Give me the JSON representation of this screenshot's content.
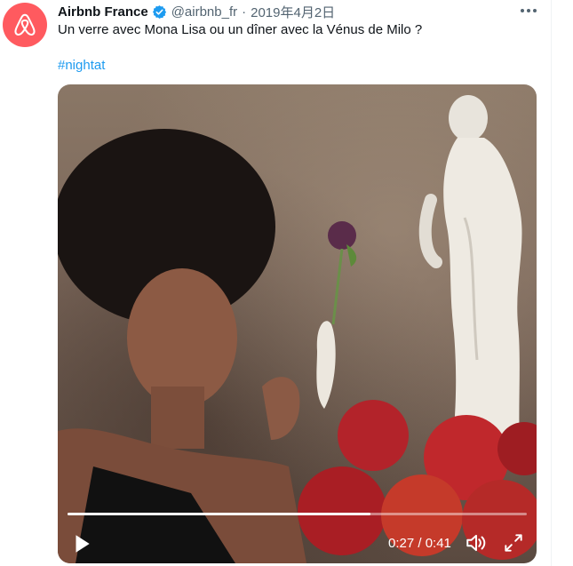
{
  "tweet": {
    "author_name": "Airbnb France",
    "handle": "@airbnb_fr",
    "separator": "·",
    "date": "2019年4月2日",
    "text": "Un verre avec Mona Lisa ou un dîner avec la Vénus de Milo ?",
    "hashtag": "#nightat"
  },
  "video": {
    "current_time": "0:27",
    "duration": "0:41",
    "time_display": "0:27 / 0:41",
    "progress": 0.66
  },
  "colors": {
    "brand": "#ff5a5f",
    "link": "#1d9bf0",
    "verified": "#1d9bf0",
    "muted_text": "#536471"
  },
  "icons": {
    "avatar": "airbnb-logo-icon",
    "verified": "verified-badge-icon",
    "more": "more-icon",
    "play": "play-icon",
    "volume": "volume-icon",
    "fullscreen": "fullscreen-icon"
  }
}
